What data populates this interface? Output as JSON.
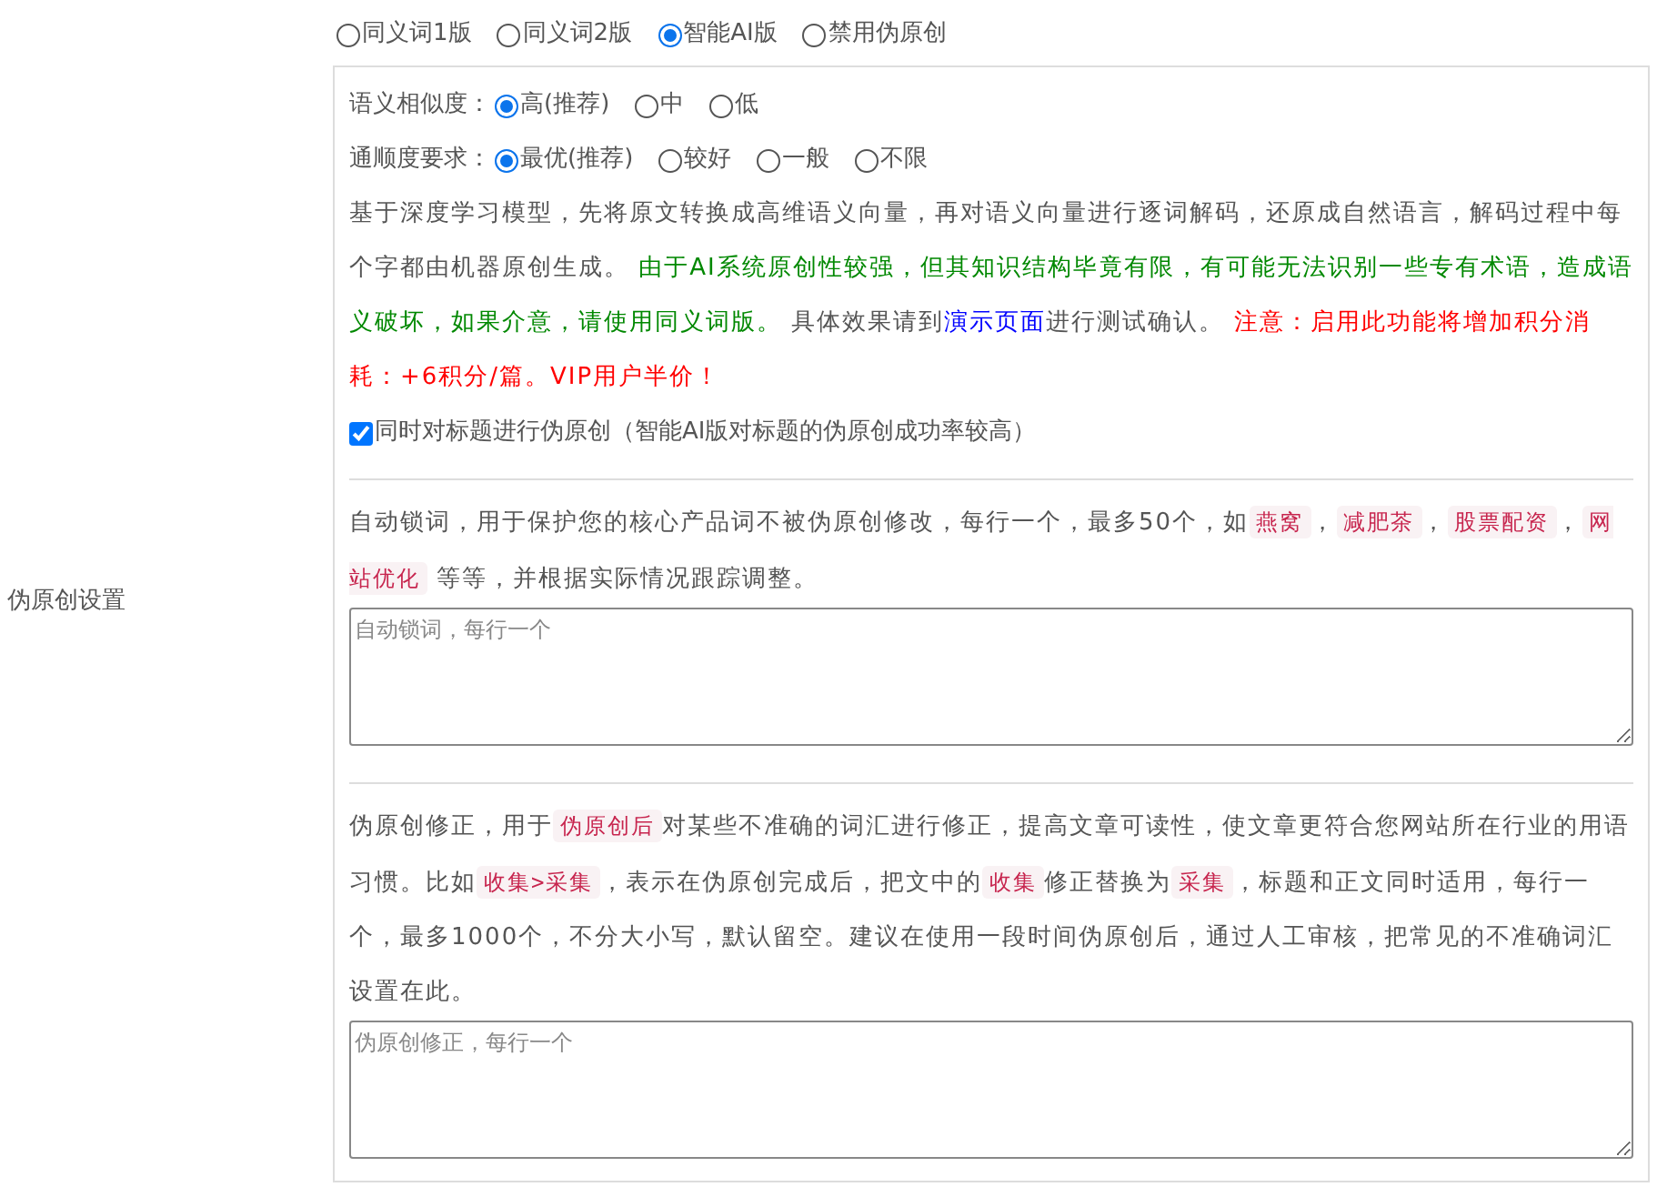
{
  "section_label": "伪原创设置",
  "mode_options": [
    {
      "label": "同义词1版",
      "selected": false
    },
    {
      "label": "同义词2版",
      "selected": false
    },
    {
      "label": "智能AI版",
      "selected": true
    },
    {
      "label": "禁用伪原创",
      "selected": false
    }
  ],
  "similarity": {
    "label": "语义相似度：",
    "options": [
      {
        "label": "高(推荐)",
        "selected": true
      },
      {
        "label": "中",
        "selected": false
      },
      {
        "label": "低",
        "selected": false
      }
    ]
  },
  "fluency": {
    "label": "通顺度要求：",
    "options": [
      {
        "label": "最优(推荐)",
        "selected": true
      },
      {
        "label": "较好",
        "selected": false
      },
      {
        "label": "一般",
        "selected": false
      },
      {
        "label": "不限",
        "selected": false
      }
    ]
  },
  "ai_description": [
    {
      "kind": "plain",
      "text": "基于深度学习模型，先将原文转换成高维语义向量，再对语义向量进行逐词解码，还原成自然语言，解码过程中每个字都由机器原创生成。 "
    },
    {
      "kind": "green",
      "text": "由于AI系统原创性较强，但其知识结构毕竟有限，有可能无法识别一些专有术语，造成语义破坏，如果介意，请使用同义词版。"
    },
    {
      "kind": "plain",
      "text": " 具体效果请到"
    },
    {
      "kind": "link",
      "text": "演示页面"
    },
    {
      "kind": "plain",
      "text": "进行测试确认。 "
    },
    {
      "kind": "red",
      "text": "注意：启用此功能将增加积分消耗：+6积分/篇。VIP用户半价！"
    }
  ],
  "title_option": {
    "label": "同时对标题进行伪原创（智能AI版对标题的伪原创成功率较高）",
    "checked": true
  },
  "lock_words": {
    "description": [
      {
        "kind": "plain",
        "text": "自动锁词，用于保护您的核心产品词不被伪原创修改，每行一个，最多50个，如"
      },
      {
        "kind": "code",
        "text": "燕窝"
      },
      {
        "kind": "plain",
        "text": "，"
      },
      {
        "kind": "code",
        "text": "减肥茶"
      },
      {
        "kind": "plain",
        "text": "，"
      },
      {
        "kind": "code",
        "text": "股票配资"
      },
      {
        "kind": "plain",
        "text": "，"
      },
      {
        "kind": "code",
        "text": "网站优化"
      },
      {
        "kind": "plain",
        "text": " 等等，并根据实际情况跟踪调整。"
      }
    ],
    "placeholder": "自动锁词，每行一个"
  },
  "correction": {
    "description": [
      {
        "kind": "plain",
        "text": "伪原创修正，用于"
      },
      {
        "kind": "code",
        "text": "伪原创后"
      },
      {
        "kind": "plain",
        "text": "对某些不准确的词汇进行修正，提高文章可读性，使文章更符合您网站所在行业的用语习惯。比如"
      },
      {
        "kind": "code",
        "text": "收集>采集"
      },
      {
        "kind": "plain",
        "text": "，表示在伪原创完成后，把文中的"
      },
      {
        "kind": "code",
        "text": "收集"
      },
      {
        "kind": "plain",
        "text": "修正替换为"
      },
      {
        "kind": "code",
        "text": "采集"
      },
      {
        "kind": "plain",
        "text": "，标题和正文同时适用，每行一个，最多1000个，不分大小写，默认留空。建议在使用一段时间伪原创后，通过人工审核，把常见的不准确词汇设置在此。"
      }
    ],
    "placeholder": "伪原创修正，每行一个"
  }
}
